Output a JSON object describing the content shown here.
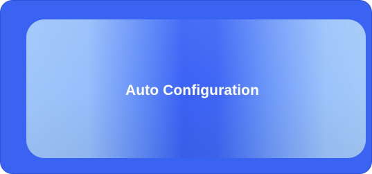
{
  "button": {
    "label": "Auto Configuration"
  },
  "colors": {
    "frame": "#3b63f2",
    "gradient_edge": "#9fc6fb",
    "gradient_center": "#3c62f5",
    "text": "#ffffff"
  }
}
